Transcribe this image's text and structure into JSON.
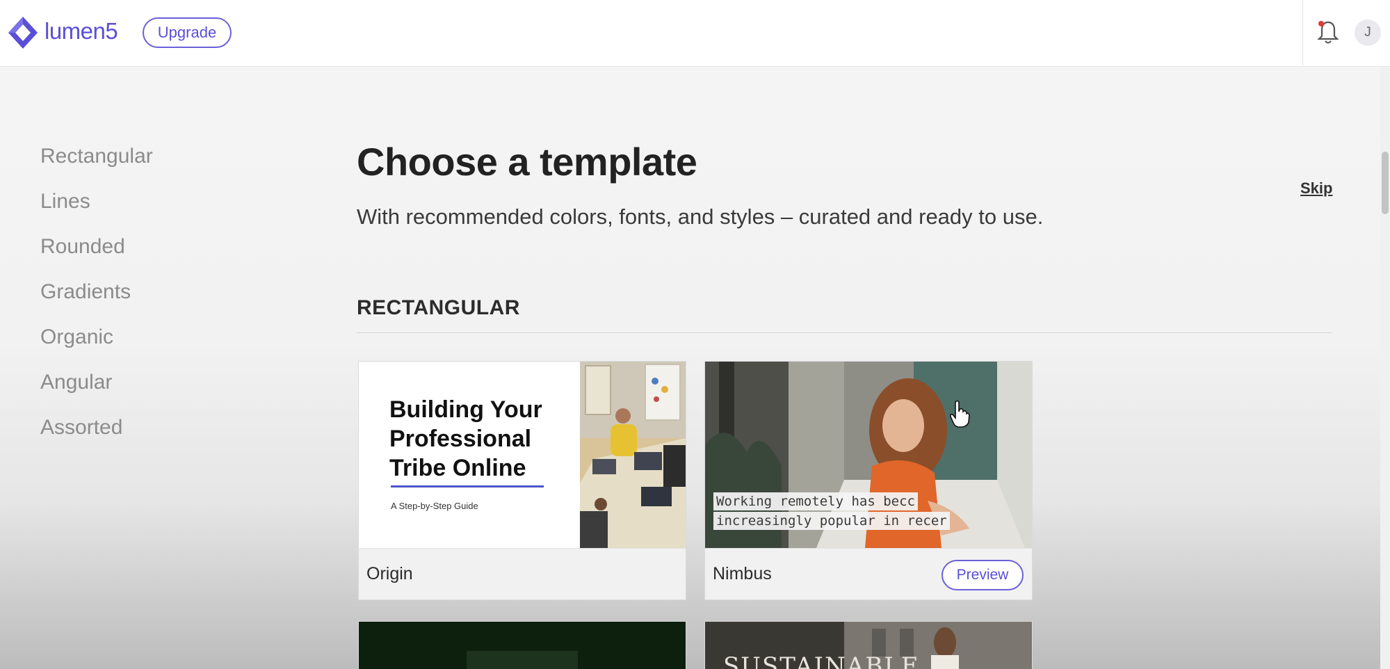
{
  "header": {
    "brand": "lumen5",
    "upgrade_label": "Upgrade",
    "avatar_initial": "J",
    "brand_color": "#5a4fd6"
  },
  "sidebar": {
    "items": [
      {
        "label": "Rectangular"
      },
      {
        "label": "Lines"
      },
      {
        "label": "Rounded"
      },
      {
        "label": "Gradients"
      },
      {
        "label": "Organic"
      },
      {
        "label": "Angular"
      },
      {
        "label": "Assorted"
      }
    ]
  },
  "main": {
    "title": "Choose a template",
    "subtitle": "With recommended colors, fonts, and styles – curated and ready to use.",
    "skip_label": "Skip",
    "section_title": "RECTANGULAR"
  },
  "cards": [
    {
      "name": "Origin",
      "thumb_headline": "Building Your Professional Tribe Online",
      "thumb_subtitle": "A Step-by-Step Guide"
    },
    {
      "name": "Nimbus",
      "preview_label": "Preview",
      "caption_line1": "Working remotely has becc",
      "caption_line2": "increasingly popular in recer"
    },
    {
      "thumb_text": "SUSTAINABLE"
    }
  ],
  "icons": {
    "logo": "lumen5-logo",
    "notifications": "bell-icon",
    "cursor": "hand-cursor-icon"
  },
  "colors": {
    "accent": "#6a60d8",
    "notification_dot": "#e53935"
  }
}
